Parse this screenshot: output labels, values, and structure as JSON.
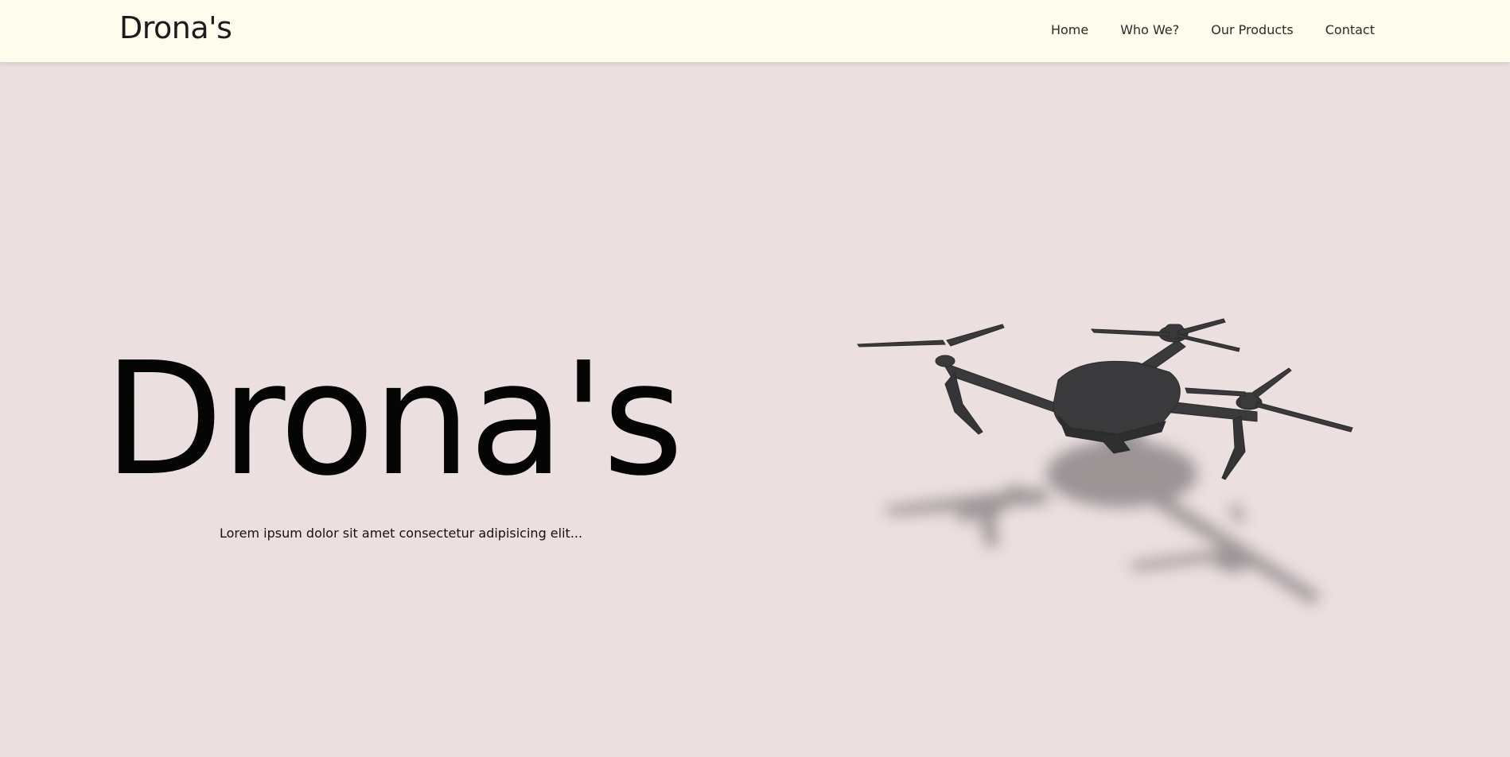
{
  "header": {
    "brand": "Drona's",
    "nav": [
      {
        "label": "Home"
      },
      {
        "label": "Who We?"
      },
      {
        "label": "Our Products"
      },
      {
        "label": "Contact"
      }
    ]
  },
  "hero": {
    "title": "Drona's",
    "subtitle": "Lorem ipsum dolor sit amet consectetur adipisicing elit..."
  },
  "colors": {
    "navbar_bg": "#fffdee",
    "page_bg": "#ebdfe0",
    "drone": "#3a3a3c",
    "shadow": "#8f8789"
  },
  "icons": {
    "drone": "drone-illustration"
  }
}
